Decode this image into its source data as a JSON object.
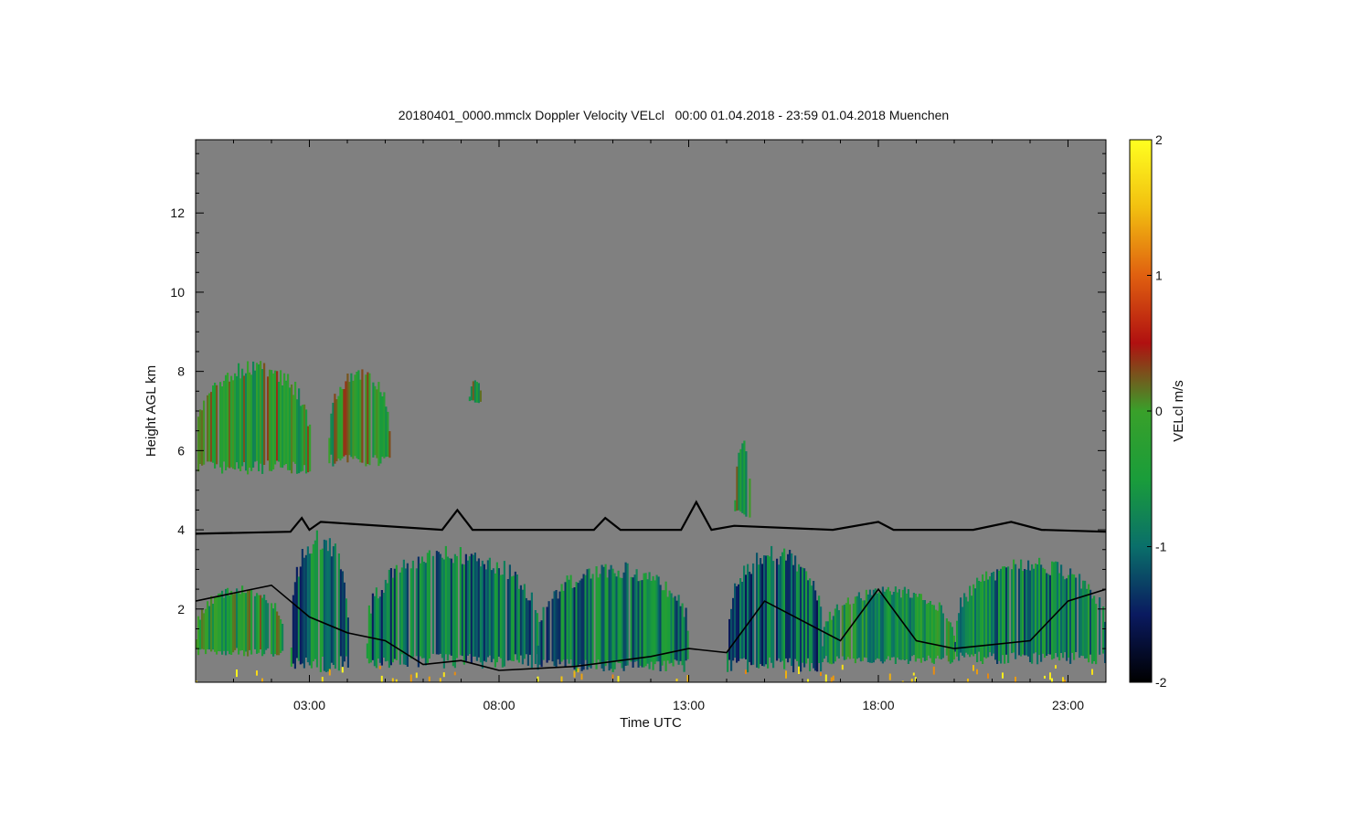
{
  "chart_data": {
    "type": "heatmap",
    "title": "20180401_0000.mmclx Doppler Velocity VELcl   00:00 01.04.2018 - 23:59 01.04.2018 Muenchen",
    "xlabel": "Time UTC",
    "ylabel": "Height AGL km",
    "xlim": [
      0.0,
      24.0
    ],
    "ylim": [
      0.15,
      13.85
    ],
    "x_tick_values": [
      3,
      8,
      13,
      18,
      23
    ],
    "x_tick_labels": [
      "03:00",
      "08:00",
      "13:00",
      "18:00",
      "23:00"
    ],
    "y_tick_values": [
      2,
      4,
      6,
      8,
      10,
      12
    ],
    "y_tick_labels": [
      "2",
      "4",
      "6",
      "8",
      "10",
      "12"
    ],
    "background_color": "#808080",
    "colorbar": {
      "label": "VELcl m/s",
      "range": [
        -2,
        2
      ],
      "tick_values": [
        2,
        1,
        0,
        -1,
        -2
      ],
      "tick_labels": [
        "2",
        "1",
        "0",
        "-1",
        "-2"
      ],
      "colormap": [
        "#000000",
        "#0a1a60",
        "#0a6f6a",
        "#1a9d3a",
        "#39a02a",
        "#b01010",
        "#e06010",
        "#f2c010",
        "#ffff20"
      ]
    },
    "cloud_regions": [
      {
        "x": [
          0.0,
          3.0
        ],
        "y": [
          5.4,
          8.3
        ],
        "velocity": -0.2
      },
      {
        "x": [
          3.5,
          5.1
        ],
        "y": [
          5.6,
          8.1
        ],
        "velocity": -0.2
      },
      {
        "x": [
          7.2,
          7.5
        ],
        "y": [
          7.2,
          7.8
        ],
        "velocity": -0.2
      },
      {
        "x": [
          14.2,
          14.6
        ],
        "y": [
          4.3,
          6.3
        ],
        "velocity": -0.3
      },
      {
        "x": [
          0.0,
          2.3
        ],
        "y": [
          0.8,
          2.6
        ],
        "velocity": -0.3
      },
      {
        "x": [
          2.5,
          4.0
        ],
        "y": [
          0.4,
          4.0
        ],
        "velocity": -0.9
      },
      {
        "x": [
          4.5,
          9.0
        ],
        "y": [
          0.5,
          3.6
        ],
        "velocity": -0.9
      },
      {
        "x": [
          9.0,
          13.0
        ],
        "y": [
          0.4,
          3.2
        ],
        "velocity": -0.9
      },
      {
        "x": [
          14.0,
          16.5
        ],
        "y": [
          0.4,
          3.6
        ],
        "velocity": -1.0
      },
      {
        "x": [
          16.5,
          20.0
        ],
        "y": [
          0.6,
          2.6
        ],
        "velocity": -0.5
      },
      {
        "x": [
          20.0,
          24.0
        ],
        "y": [
          0.6,
          3.3
        ],
        "velocity": -0.8
      }
    ],
    "series": [
      {
        "x": [
          0.0,
          2.5,
          2.8,
          3.0,
          3.3,
          6.5,
          6.9,
          7.3,
          10.5,
          10.8,
          11.2,
          12.8,
          13.2,
          13.6,
          14.2,
          16.8,
          18.0,
          18.4,
          20.5,
          21.5,
          22.3,
          24.0
        ],
        "y": [
          3.9,
          3.95,
          4.3,
          4.0,
          4.2,
          4.0,
          4.5,
          4.0,
          4.0,
          4.3,
          4.0,
          4.0,
          4.7,
          4.0,
          4.1,
          4.0,
          4.2,
          4.0,
          4.0,
          4.2,
          4.0,
          3.95
        ]
      },
      {
        "x": [
          0.0,
          1.0,
          2.0,
          3.0,
          4.0,
          5.0,
          6.0,
          7.0,
          8.0,
          10.0,
          12.0,
          13.0,
          14.0,
          15.0,
          17.0,
          18.0,
          19.0,
          20.0,
          21.0,
          22.0,
          23.0,
          24.0
        ],
        "y": [
          2.2,
          2.4,
          2.6,
          1.8,
          1.4,
          1.2,
          0.6,
          0.7,
          0.45,
          0.55,
          0.8,
          1.0,
          0.9,
          2.2,
          1.2,
          2.5,
          1.2,
          1.0,
          1.1,
          1.2,
          2.2,
          2.5
        ]
      }
    ]
  }
}
